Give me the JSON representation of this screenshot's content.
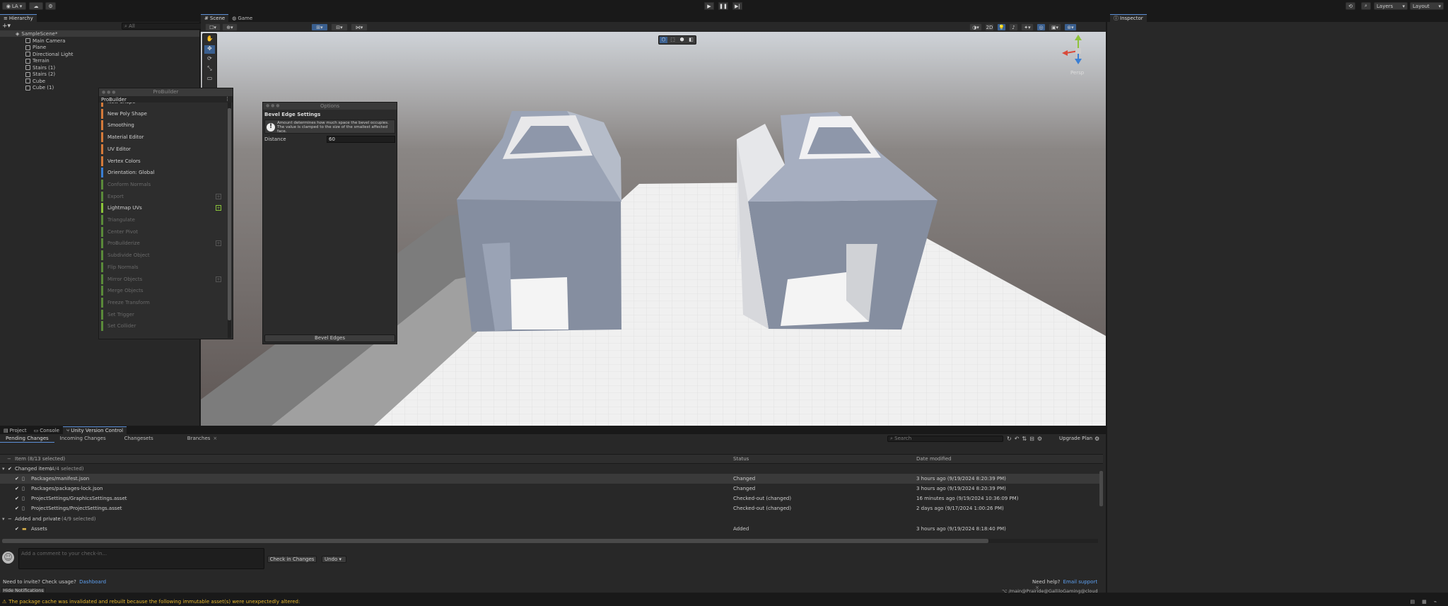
{
  "toolbar": {
    "account": "LA",
    "layers_label": "Layers",
    "layout_label": "Layout"
  },
  "hierarchy": {
    "tab_label": "Hierarchy",
    "search_placeholder": "All",
    "scene_name": "SampleScene*",
    "items": [
      "Main Camera",
      "Plane",
      "Directional Light",
      "Terrain",
      "Stairs (1)",
      "Stairs (2)",
      "Cube",
      "Cube (1)"
    ]
  },
  "scene": {
    "tab_scene": "Scene",
    "tab_game": "Game",
    "persp_label": "Persp"
  },
  "probuilder": {
    "title": "ProBuilder",
    "tab_label": "ProBuilder",
    "items": [
      {
        "label": "New Shape",
        "color": "#d47a3a",
        "enabled": true
      },
      {
        "label": "New Poly Shape",
        "color": "#d47a3a",
        "enabled": true
      },
      {
        "label": "Smoothing",
        "color": "#d47a3a",
        "enabled": true
      },
      {
        "label": "Material Editor",
        "color": "#d47a3a",
        "enabled": true
      },
      {
        "label": "UV Editor",
        "color": "#d47a3a",
        "enabled": true
      },
      {
        "label": "Vertex Colors",
        "color": "#d47a3a",
        "enabled": true
      },
      {
        "label": "Orientation: Global",
        "color": "#3a7fd4",
        "enabled": true
      },
      {
        "label": "Conform Normals",
        "color": "#5a8a3a",
        "enabled": false
      },
      {
        "label": "Export",
        "color": "#5a8a3a",
        "enabled": false
      },
      {
        "label": "Lightmap UVs",
        "color": "#8ac43a",
        "enabled": true
      },
      {
        "label": "Triangulate",
        "color": "#5a8a3a",
        "enabled": false
      },
      {
        "label": "Center Pivot",
        "color": "#5a8a3a",
        "enabled": false
      },
      {
        "label": "ProBuilderize",
        "color": "#5a8a3a",
        "enabled": false
      },
      {
        "label": "Subdivide Object",
        "color": "#5a8a3a",
        "enabled": false
      },
      {
        "label": "Flip Normals",
        "color": "#5a8a3a",
        "enabled": false
      },
      {
        "label": "Mirror Objects",
        "color": "#5a8a3a",
        "enabled": false
      },
      {
        "label": "Merge Objects",
        "color": "#5a8a3a",
        "enabled": false
      },
      {
        "label": "Freeze Transform",
        "color": "#5a8a3a",
        "enabled": false
      },
      {
        "label": "Set Trigger",
        "color": "#5a8a3a",
        "enabled": false
      },
      {
        "label": "Set Collider",
        "color": "#5a8a3a",
        "enabled": false
      }
    ]
  },
  "options": {
    "title": "Options",
    "header": "Bevel Edge Settings",
    "info_text": "Amount determines how much space the bevel occupies. The value is clamped to the size of the smallest affected face.",
    "distance_label": "Distance",
    "distance_value": "60",
    "apply_label": "Bevel Edges"
  },
  "inspector": {
    "tab_label": "Inspector"
  },
  "bottom": {
    "tabs": [
      "Project",
      "Console",
      "Unity Version Control"
    ],
    "subtabs": [
      "Pending Changes",
      "Incoming Changes",
      "Changesets",
      "Branches"
    ],
    "search_placeholder": "Search",
    "upgrade_label": "Upgrade Plan",
    "col_item": "Item (8/13 selected)",
    "col_status": "Status",
    "col_date": "Date modified",
    "group_changed": "Changed items",
    "group_changed_count": "(4/4 selected)",
    "group_added": "Added and private",
    "group_added_count": "(4/9 selected)",
    "rows": [
      {
        "name": "Packages/manifest.json",
        "status": "Changed",
        "date": "3 hours ago (9/19/2024 8:20:39 PM)"
      },
      {
        "name": "Packages/packages-lock.json",
        "status": "Changed",
        "date": "3 hours ago (9/19/2024 8:20:39 PM)"
      },
      {
        "name": "ProjectSettings/GraphicsSettings.asset",
        "status": "Checked-out (changed)",
        "date": "16 minutes ago (9/19/2024 10:36:09 PM)"
      },
      {
        "name": "ProjectSettings/ProjectSettings.asset",
        "status": "Checked-out (changed)",
        "date": "2 days ago (9/17/2024 1:00:26 PM)"
      }
    ],
    "added_row": {
      "name": "Assets",
      "status": "Added",
      "date": "3 hours ago (9/19/2024 8:18:40 PM)"
    },
    "comment_placeholder": "Add a comment to your check-in...",
    "checkin_label": "Check in Changes",
    "undo_label": "Undo",
    "invite_text": "Need to invite? Check usage?",
    "dashboard_link": "Dashboard",
    "help_text": "Need help?",
    "email_link": "Email support",
    "hide_notifications": "Hide Notifications",
    "user": "/main@Prairide@GalliloGaming@cloud"
  },
  "status": {
    "message": "The package cache was invalidated and rebuilt because the following immutable asset(s) were unexpectedly altered:"
  }
}
